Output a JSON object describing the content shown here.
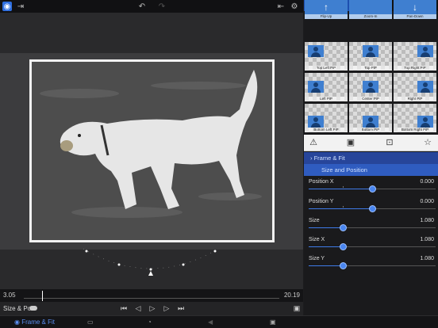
{
  "colors": {
    "accent": "#3f7be8",
    "panel": "#1a1a1c",
    "section_header": "#27459a",
    "section_sub": "#2f5cc0"
  },
  "topbar": {
    "icons": [
      "app-icon",
      "import-icon",
      "undo-icon",
      "redo-icon",
      "export-icon",
      "settings-icon"
    ]
  },
  "timeline": {
    "start": "3.05",
    "end": "20.19",
    "progress": 0.07
  },
  "controls": {
    "mode_label": "Size & Pos",
    "transport": [
      "skip-start-icon",
      "step-back-icon",
      "play-icon",
      "step-forward-icon",
      "skip-end-icon"
    ]
  },
  "bottombar": {
    "active_tab": "Frame & Fit"
  },
  "panel": {
    "tabs": [
      "settings-tab",
      "favorites-tab"
    ],
    "presets": [
      "Flip-Up",
      "Zoom-In",
      "Pan-Down",
      "Top Left PiP",
      "Top PiP",
      "Top Right PiP",
      "Left PiP",
      "Center PiP",
      "Right PiP",
      "Bottom Left PiP",
      "Bottom PiP",
      "Bottom Right PiP"
    ],
    "section": "Frame & Fit",
    "subsection": "Size and Position",
    "params": [
      {
        "name": "Position X",
        "value": "0.000",
        "level": 0.5
      },
      {
        "name": "Position Y",
        "value": "0.000",
        "level": 0.5
      },
      {
        "name": "Size",
        "value": "1.080",
        "level": 0.27
      },
      {
        "name": "Size X",
        "value": "1.080",
        "level": 0.27
      },
      {
        "name": "Size Y",
        "value": "1.080",
        "level": 0.27
      }
    ]
  }
}
